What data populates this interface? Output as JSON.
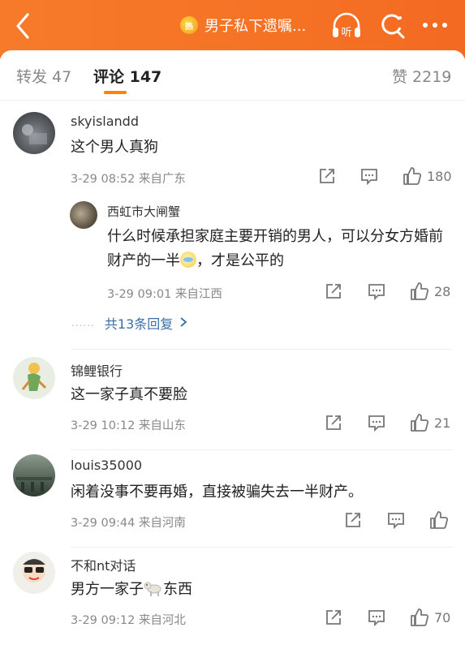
{
  "header": {
    "title": "男子私下遗嘱...",
    "badge_text": "热",
    "listen_label": "听",
    "bg_color": "#f57225"
  },
  "tabs": {
    "repost": "转发 47",
    "comment": "评论 147",
    "like": "赞 2219"
  },
  "comments": [
    {
      "user": "skyislandd",
      "text": "这个男人真狗",
      "meta": "3-29 08:52  来自广东",
      "likes": "180",
      "reply": {
        "user": "西虹市大闸蟹",
        "text": "什么时候承担家庭主要开销的男人，可以分女方婚前财产的一半",
        "text_tail": "，才是公平的",
        "meta": "3-29 09:01  来自江西",
        "likes": "28"
      },
      "more_replies": "共13条回复"
    },
    {
      "user": "锦鲤银行",
      "text": "这一家子真不要脸",
      "meta": "3-29 10:12  来自山东",
      "likes": "21"
    },
    {
      "user": "louis35000",
      "text": "闲着没事不要再婚，直接被骗失去一半财产。",
      "meta": "3-29 09:44  来自河南",
      "likes": ""
    },
    {
      "user": "不和nt对话",
      "text": "男方一家子",
      "text_tail": "东西",
      "meta": "3-29 09:12  来自河北",
      "likes": "70"
    }
  ],
  "icons": [
    "back-icon",
    "hot-badge-icon",
    "listen-icon",
    "search-icon",
    "more-icon",
    "repost-icon",
    "comment-icon",
    "like-icon",
    "chevron-right-icon",
    "dog-emoji-icon",
    "sweat-emoji-icon"
  ]
}
